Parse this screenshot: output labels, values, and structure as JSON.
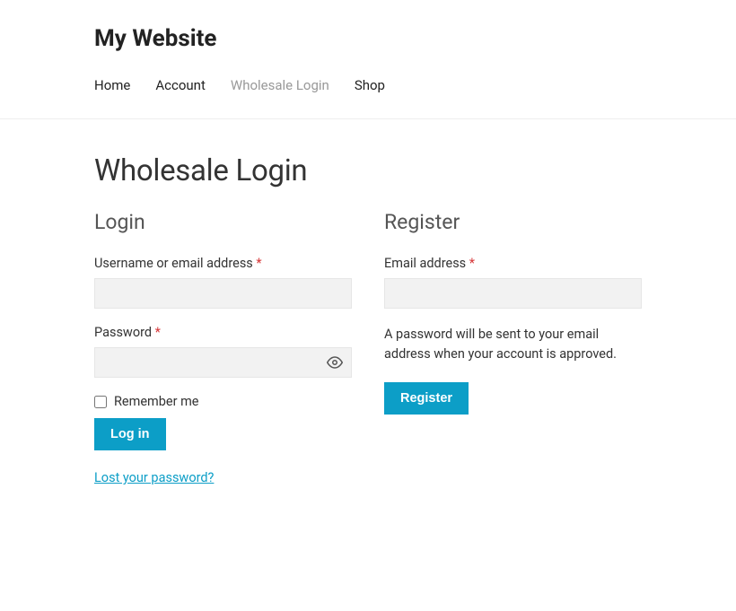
{
  "site": {
    "title": "My Website"
  },
  "nav": {
    "items": [
      {
        "label": "Home",
        "current": false
      },
      {
        "label": "Account",
        "current": false
      },
      {
        "label": "Wholesale Login",
        "current": true
      },
      {
        "label": "Shop",
        "current": false
      }
    ]
  },
  "page": {
    "title": "Wholesale Login"
  },
  "login": {
    "heading": "Login",
    "username_label": "Username or email address",
    "username_required": "*",
    "password_label": "Password",
    "password_required": "*",
    "remember_label": "Remember me",
    "submit_label": "Log in",
    "lost_label": "Lost your password?"
  },
  "register": {
    "heading": "Register",
    "email_label": "Email address",
    "email_required": "*",
    "helper": "A password will be sent to your email address when your account is approved.",
    "submit_label": "Register"
  }
}
